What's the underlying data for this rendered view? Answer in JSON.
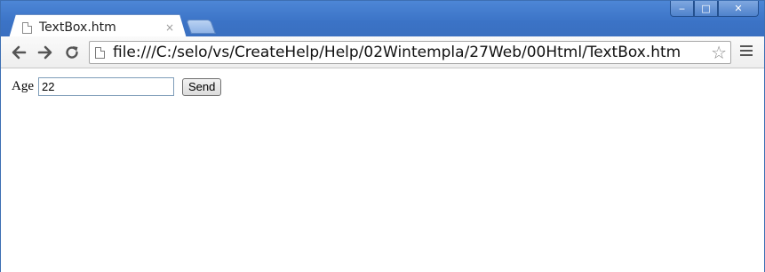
{
  "window": {
    "controls": {
      "minimize": "‒",
      "maximize": "□",
      "close": "✕"
    }
  },
  "tab": {
    "title": "TextBox.htm",
    "close": "×",
    "icon": "page-icon"
  },
  "toolbar": {
    "back_icon": "back-arrow-icon",
    "forward_icon": "forward-arrow-icon",
    "reload_icon": "reload-icon",
    "url": "file:///C:/selo/vs/CreateHelp/Help/02Wintempla/27Web/00Html/TextBox.htm",
    "star_icon": "star-icon",
    "star": "☆",
    "menu_icon": "menu-icon"
  },
  "form": {
    "age_label": "Age",
    "age_value": "22",
    "send_label": "Send"
  },
  "colors": {
    "titlebar": "#3b73c6",
    "accent": "#4d86d6"
  }
}
